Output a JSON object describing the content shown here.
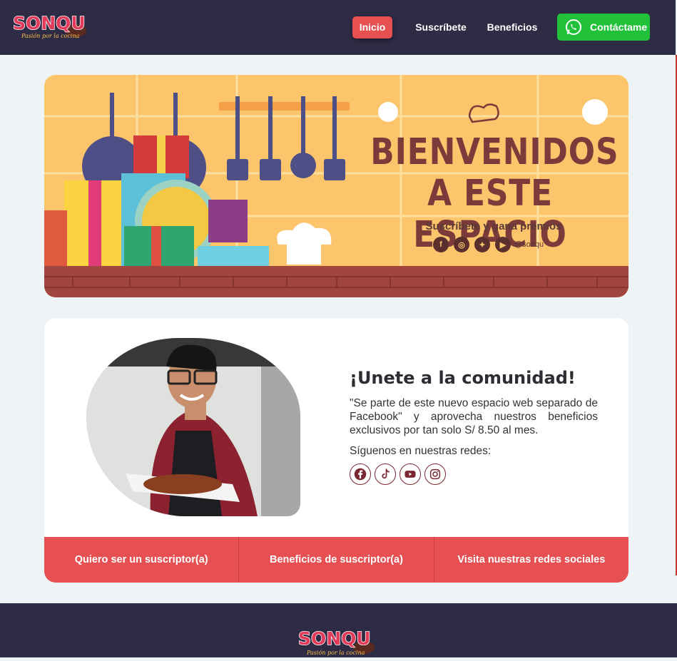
{
  "brand": {
    "logo_text": "SONQU",
    "tagline": "Pasión por la cocina"
  },
  "nav": {
    "items": [
      {
        "label": "Inicio"
      },
      {
        "label": "Suscríbete"
      },
      {
        "label": "Beneficios"
      }
    ],
    "contact_label": "Contáctame"
  },
  "banner": {
    "title_line1": "BIENVENIDOS",
    "title_line2": "A ESTE ESPACIO",
    "subtitle": "Suscríbete y gana premios",
    "handle": "@sonqu"
  },
  "community": {
    "heading": "¡Unete a la comunidad!",
    "body": "\"Se parte de este nuevo espacio web separado de Facebook\" y aprovecha nuestros beneficios exclusivos por tan solo S/ 8.50 al mes.",
    "follow_label": "Síguenos en nuestras redes:",
    "social_icons": [
      "facebook-icon",
      "tiktok-icon",
      "youtube-icon",
      "instagram-icon"
    ]
  },
  "actions": [
    {
      "label": "Quiero ser un suscriptor(a)"
    },
    {
      "label": "Beneficios de suscriptor(a)"
    },
    {
      "label": "Visita nuestras redes sociales"
    }
  ],
  "colors": {
    "navy": "#2e2b45",
    "accent": "#e65051",
    "whatsapp": "#22c13a",
    "banner_bg": "#fcc56c",
    "banner_text": "#7b3b3a"
  }
}
